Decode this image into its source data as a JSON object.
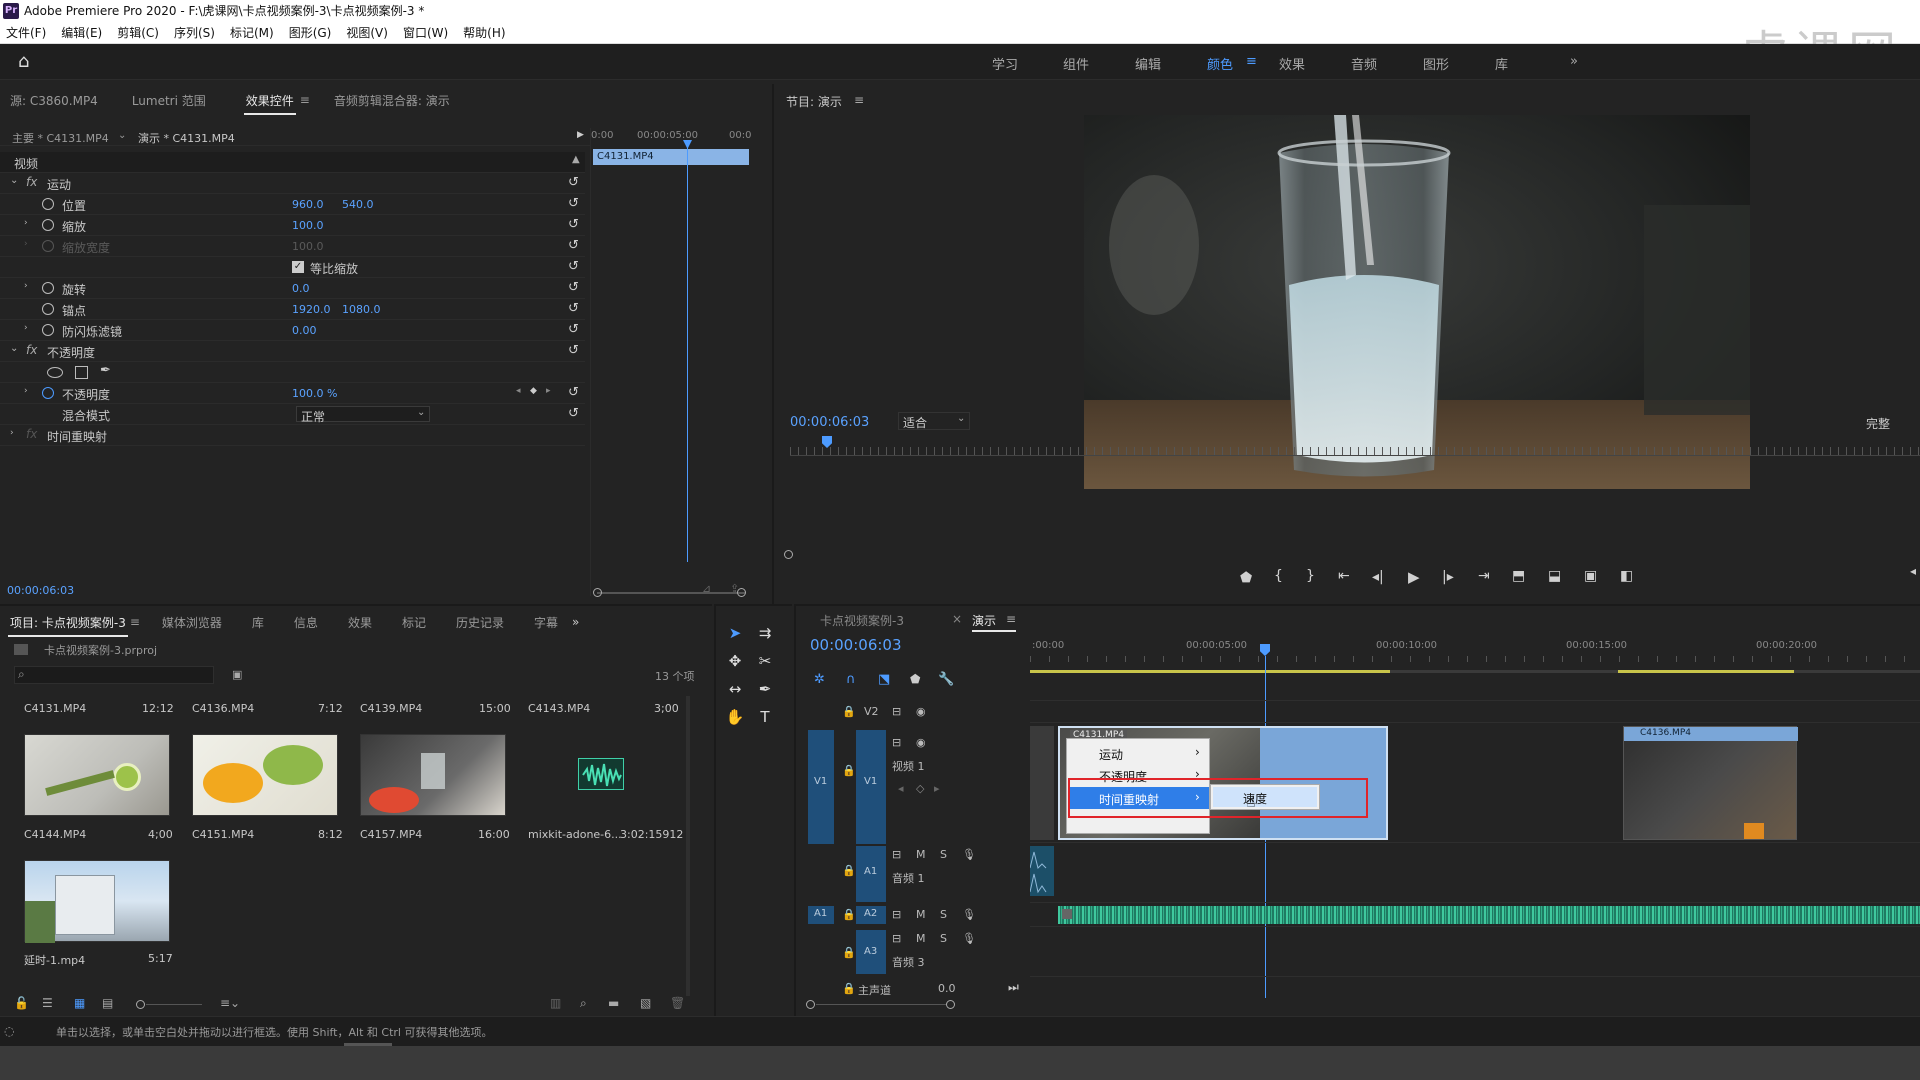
{
  "app": {
    "title": "Adobe Premiere Pro 2020 - F:\\虎课网\\卡点视频案例-3\\卡点视频案例-3 *",
    "icon": "Pr",
    "watermark": "虎课网"
  },
  "menu": [
    "文件(F)",
    "编辑(E)",
    "剪辑(C)",
    "序列(S)",
    "标记(M)",
    "图形(G)",
    "视图(V)",
    "窗口(W)",
    "帮助(H)"
  ],
  "workspaces": [
    "学习",
    "组件",
    "编辑",
    "颜色",
    "效果",
    "音频",
    "图形",
    "库"
  ],
  "workspace_active": "颜色",
  "workspace_more": "»",
  "source_tabs": [
    "源: C3860.MP4",
    "Lumetri 范围",
    "效果控件",
    "音频剪辑混合器: 演示"
  ],
  "ec": {
    "master": "主要 * C4131.MP4",
    "sequence_clip": "演示 * C4131.MP4",
    "t0": "0:00",
    "t1": "00:00:05:00",
    "t2": "00:0",
    "clip_label": "C4131.MP4",
    "section": "视频",
    "motion": "运动",
    "position": "位置",
    "pos_x": "960.0",
    "pos_y": "540.0",
    "scale": "缩放",
    "scale_val": "100.0",
    "scale_width": "缩放宽度",
    "scale_width_val": "100.0",
    "uniform": "等比缩放",
    "rotation": "旋转",
    "rotation_val": "0.0",
    "anchor": "锚点",
    "anchor_x": "1920.0",
    "anchor_y": "1080.0",
    "flicker": "防闪烁滤镜",
    "flicker_val": "0.00",
    "opacity_group": "不透明度",
    "opacity": "不透明度",
    "opacity_val": "100.0 %",
    "blend": "混合模式",
    "blend_val": "正常",
    "time_remap": "时间重映射",
    "timecode": "00:00:06:03"
  },
  "program": {
    "title": "节目: 演示",
    "timecode": "00:00:06:03",
    "fit": "适合",
    "quality": "完整"
  },
  "project": {
    "tabs": [
      "项目: 卡点视频案例-3",
      "媒体浏览器",
      "库",
      "信息",
      "效果",
      "标记",
      "历史记录",
      "字幕"
    ],
    "file": "卡点视频案例-3.prproj",
    "count": "13 个项",
    "items": [
      {
        "name": "C4131.MP4",
        "dur": "12:12"
      },
      {
        "name": "C4136.MP4",
        "dur": "7:12"
      },
      {
        "name": "C4139.MP4",
        "dur": "15:00"
      },
      {
        "name": "C4143.MP4",
        "dur": "3;00"
      },
      {
        "name": "C4144.MP4",
        "dur": "4;00"
      },
      {
        "name": "C4151.MP4",
        "dur": "8:12"
      },
      {
        "name": "C4157.MP4",
        "dur": "16:00"
      },
      {
        "name": "mixkit-adone-6...",
        "dur": "3:02:15912"
      },
      {
        "name": "延时-1.mp4",
        "dur": "5:17"
      }
    ]
  },
  "timeline": {
    "tabs": [
      "卡点视频案例-3",
      "演示"
    ],
    "close": "×",
    "timecode": "00:00:06:03",
    "ruler": [
      ":00:00",
      "00:00:05:00",
      "00:00:10:00",
      "00:00:15:00",
      "00:00:20:00"
    ],
    "tracks": {
      "v2": "V2",
      "v1": "V1",
      "v1_src": "V1",
      "v1_name": "视频 1",
      "a1": "A1",
      "a1_src": "A1",
      "a1_name": "音频 1",
      "a2": "A2",
      "a3": "A3",
      "a3_name": "音频 3",
      "master": "主声道",
      "master_val": "0.0",
      "m": "M",
      "s": "S"
    },
    "clips": {
      "c1": "C4131.MP4",
      "c2": "C4136.MP4"
    },
    "context_menu": [
      "运动",
      "不透明度",
      "时间重映射"
    ],
    "submenu": "速度"
  },
  "status": "单击以选择，或单击空白处并拖动以进行框选。使用 Shift，Alt 和 Ctrl 可获得其他选项。"
}
